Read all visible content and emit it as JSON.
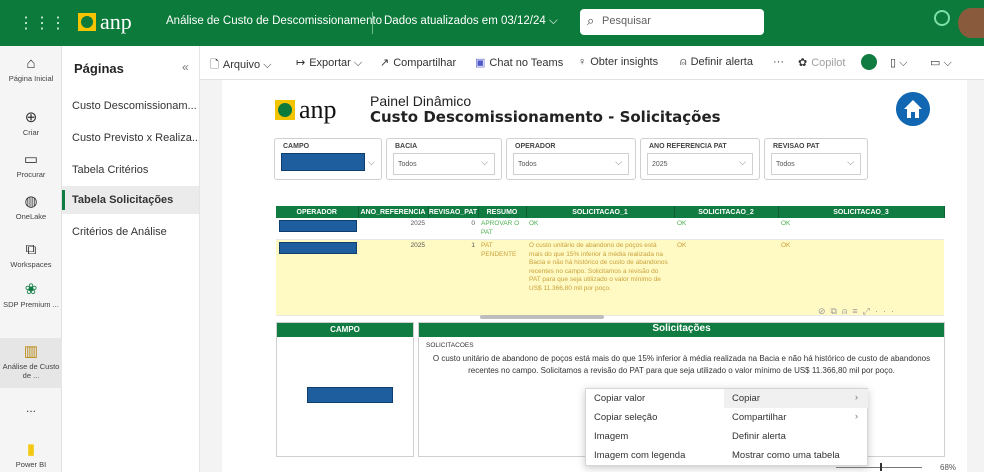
{
  "topbar": {
    "app_grid_icon": "grid-icon",
    "logo_text": "anp",
    "title": "Análise de Custo de Descomissionamento",
    "updated": "Dados atualizados em 03/12/24",
    "search_placeholder": "Pesquisar",
    "colors": {
      "brand": "#0b7a3a"
    }
  },
  "rail": [
    {
      "label": "Página Inicial",
      "icon": "home-icon"
    },
    {
      "label": "Criar",
      "icon": "plus-circle-icon"
    },
    {
      "label": "Procurar",
      "icon": "folder-icon"
    },
    {
      "label": "OneLake",
      "icon": "onelake-icon"
    },
    {
      "label": "Workspaces",
      "icon": "workspaces-icon"
    },
    {
      "label": "SDP Premium ...",
      "icon": "premium-icon"
    },
    {
      "label": "Análise de Custo de ...",
      "icon": "report-icon"
    },
    {
      "label": "...",
      "icon": "more-icon"
    },
    {
      "label": "Power BI",
      "icon": "powerbi-icon"
    }
  ],
  "pages": {
    "title": "Páginas",
    "items": [
      {
        "label": "Custo Descomissionam...",
        "active": false
      },
      {
        "label": "Custo Previsto x Realiza...",
        "active": false
      },
      {
        "label": "Tabela Critérios",
        "active": false
      },
      {
        "label": "Tabela Solicitações",
        "active": true
      },
      {
        "label": "Critérios de Análise",
        "active": false
      }
    ]
  },
  "toolbar": {
    "arquivo": "Arquivo",
    "exportar": "Exportar",
    "compartilhar": "Compartilhar",
    "chat_teams": "Chat no Teams",
    "obter_insights": "Obter insights",
    "definir_alerta": "Definir alerta",
    "more": "···",
    "copilot": "Copilot"
  },
  "report": {
    "logo_text": "anp",
    "subtitle": "Painel Dinâmico",
    "title": "Custo Descomissionamento - Solicitações",
    "slicers": [
      {
        "label": "CAMPO",
        "value": ""
      },
      {
        "label": "BACIA",
        "value": "Todos"
      },
      {
        "label": "OPERADOR",
        "value": "Todos"
      },
      {
        "label": "ANO REFERENCIA PAT",
        "value": "2025"
      },
      {
        "label": "REVISAO PAT",
        "value": "Todos"
      }
    ],
    "table": {
      "headers": [
        "OPERADOR",
        "ANO_REFERENCIA",
        "REVISAO_PAT",
        "RESUMO",
        "SOLICITACAO_1",
        "SOLICITACAO_2",
        "SOLICITACAO_3"
      ],
      "rows": [
        [
          "",
          "2025",
          "0",
          "APROVAR O PAT",
          "OK",
          "OK",
          "OK"
        ],
        [
          "",
          "2025",
          "1",
          "PAT PENDENTE",
          "O custo unitário de abandono de poços está mais do que 15% inferior à média realizada na Bacia e não há histórico de custo de abandonos recentes no campo. Solicitamos a revisão do PAT para que seja utilizado o valor mínimo de US$ 11.366,80 mil por poço.",
          "OK",
          "OK"
        ]
      ]
    },
    "campo_header": "CAMPO",
    "sol_header": "Solicitações",
    "sol_column": "SOLICITACOES",
    "sol_text": "O custo unitário de abandono de poços está mais do que 15% inferior à média realizada na Bacia e não há histórico de custo de abandonos recentes no campo. Solicitamos a revisão do PAT para que seja utilizado o valor mínimo de US$ 11.366,80 mil por poço."
  },
  "context_menu": {
    "left": [
      "Copiar valor",
      "Copiar seleção",
      "Imagem",
      "Imagem com legenda"
    ],
    "right": [
      "Copiar",
      "Compartilhar",
      "Definir alerta",
      "Mostrar como uma tabela"
    ]
  },
  "zoom": "68%"
}
